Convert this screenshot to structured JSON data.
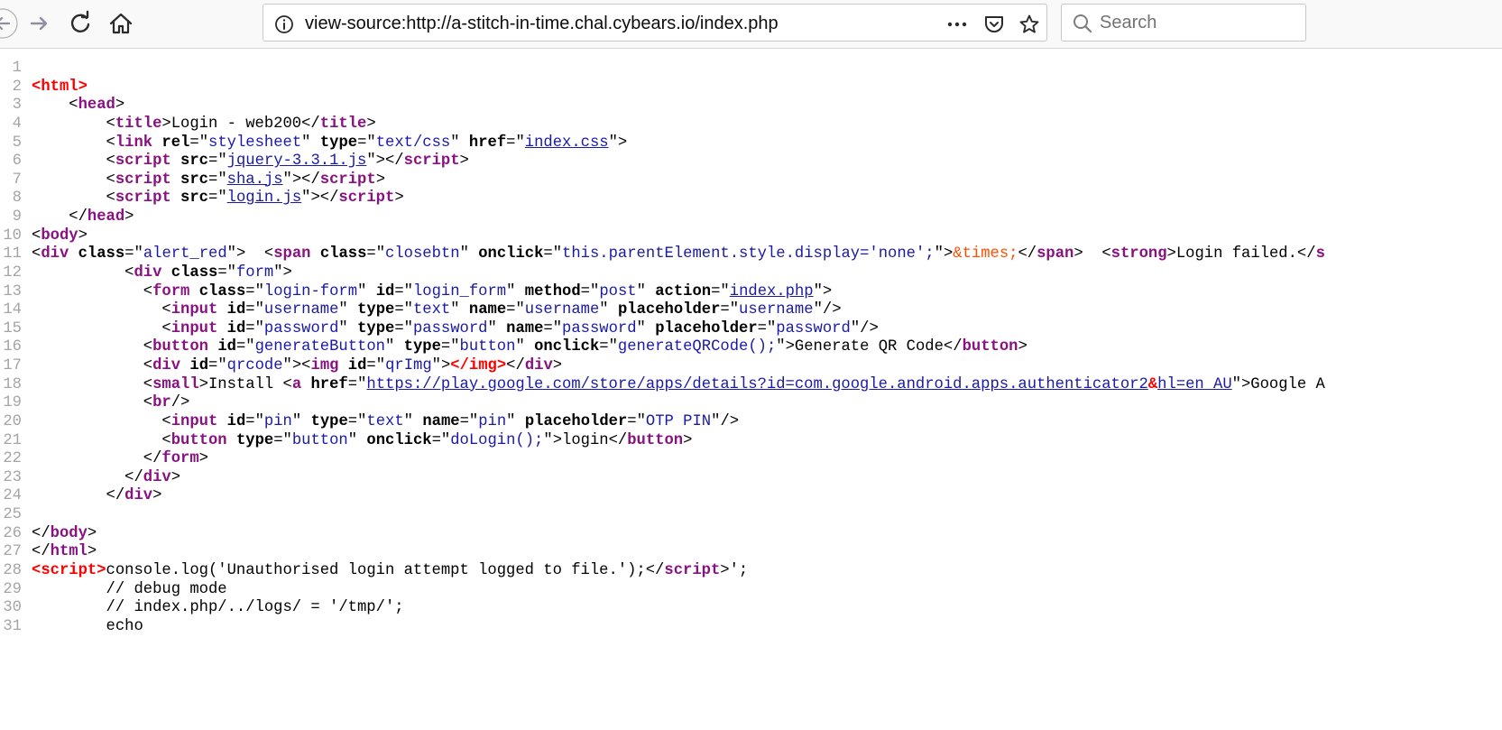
{
  "browser": {
    "url": "view-source:http://a-stitch-in-time.chal.cybears.io/index.php",
    "search_placeholder": "Search"
  },
  "source": {
    "lines": [
      [],
      [
        [
          "er",
          "<html>"
        ]
      ],
      [
        [
          "tx",
          "    <"
        ],
        [
          "tg",
          "head"
        ],
        [
          "tx",
          ">"
        ]
      ],
      [
        [
          "tx",
          "        <"
        ],
        [
          "tg",
          "title"
        ],
        [
          "tx",
          ">Login - web200</"
        ],
        [
          "tg",
          "title"
        ],
        [
          "tx",
          ">"
        ]
      ],
      [
        [
          "tx",
          "        <"
        ],
        [
          "tg",
          "link"
        ],
        [
          "tx",
          " "
        ],
        [
          "at",
          "rel"
        ],
        [
          "tx",
          "=\""
        ],
        [
          "av",
          "stylesheet"
        ],
        [
          "tx",
          "\" "
        ],
        [
          "at",
          "type"
        ],
        [
          "tx",
          "=\""
        ],
        [
          "av",
          "text/css"
        ],
        [
          "tx",
          "\" "
        ],
        [
          "at",
          "href"
        ],
        [
          "tx",
          "=\""
        ],
        [
          "lk",
          "index.css"
        ],
        [
          "tx",
          "\">"
        ]
      ],
      [
        [
          "tx",
          "        <"
        ],
        [
          "tg",
          "script"
        ],
        [
          "tx",
          " "
        ],
        [
          "at",
          "src"
        ],
        [
          "tx",
          "=\""
        ],
        [
          "lk",
          "jquery-3.3.1.js"
        ],
        [
          "tx",
          "\"></"
        ],
        [
          "tg",
          "script"
        ],
        [
          "tx",
          ">"
        ]
      ],
      [
        [
          "tx",
          "        <"
        ],
        [
          "tg",
          "script"
        ],
        [
          "tx",
          " "
        ],
        [
          "at",
          "src"
        ],
        [
          "tx",
          "=\""
        ],
        [
          "lk",
          "sha.js"
        ],
        [
          "tx",
          "\"></"
        ],
        [
          "tg",
          "script"
        ],
        [
          "tx",
          ">"
        ]
      ],
      [
        [
          "tx",
          "        <"
        ],
        [
          "tg",
          "script"
        ],
        [
          "tx",
          " "
        ],
        [
          "at",
          "src"
        ],
        [
          "tx",
          "=\""
        ],
        [
          "lk",
          "login.js"
        ],
        [
          "tx",
          "\"></"
        ],
        [
          "tg",
          "script"
        ],
        [
          "tx",
          ">"
        ]
      ],
      [
        [
          "tx",
          "    </"
        ],
        [
          "tg",
          "head"
        ],
        [
          "tx",
          ">"
        ]
      ],
      [
        [
          "tx",
          "<"
        ],
        [
          "tg",
          "body"
        ],
        [
          "tx",
          ">"
        ]
      ],
      [
        [
          "tx",
          "<"
        ],
        [
          "tg",
          "div"
        ],
        [
          "tx",
          " "
        ],
        [
          "at",
          "class"
        ],
        [
          "tx",
          "=\""
        ],
        [
          "av",
          "alert_red"
        ],
        [
          "tx",
          "\">  <"
        ],
        [
          "tg",
          "span"
        ],
        [
          "tx",
          " "
        ],
        [
          "at",
          "class"
        ],
        [
          "tx",
          "=\""
        ],
        [
          "av",
          "closebtn"
        ],
        [
          "tx",
          "\" "
        ],
        [
          "at",
          "onclick"
        ],
        [
          "tx",
          "=\""
        ],
        [
          "av",
          "this.parentElement.style.display='none';"
        ],
        [
          "tx",
          "\">"
        ],
        [
          "en",
          "&times;"
        ],
        [
          "tx",
          "</"
        ],
        [
          "tg",
          "span"
        ],
        [
          "tx",
          ">  <"
        ],
        [
          "tg",
          "strong"
        ],
        [
          "tx",
          ">Login failed.</"
        ],
        [
          "tg",
          "s"
        ]
      ],
      [
        [
          "tx",
          "          <"
        ],
        [
          "tg",
          "div"
        ],
        [
          "tx",
          " "
        ],
        [
          "at",
          "class"
        ],
        [
          "tx",
          "=\""
        ],
        [
          "av",
          "form"
        ],
        [
          "tx",
          "\">"
        ]
      ],
      [
        [
          "tx",
          "            <"
        ],
        [
          "tg",
          "form"
        ],
        [
          "tx",
          " "
        ],
        [
          "at",
          "class"
        ],
        [
          "tx",
          "=\""
        ],
        [
          "av",
          "login-form"
        ],
        [
          "tx",
          "\" "
        ],
        [
          "at",
          "id"
        ],
        [
          "tx",
          "=\""
        ],
        [
          "av",
          "login_form"
        ],
        [
          "tx",
          "\" "
        ],
        [
          "at",
          "method"
        ],
        [
          "tx",
          "=\""
        ],
        [
          "av",
          "post"
        ],
        [
          "tx",
          "\" "
        ],
        [
          "at",
          "action"
        ],
        [
          "tx",
          "=\""
        ],
        [
          "lk",
          "index.php"
        ],
        [
          "tx",
          "\">"
        ]
      ],
      [
        [
          "tx",
          "              <"
        ],
        [
          "tg",
          "input"
        ],
        [
          "tx",
          " "
        ],
        [
          "at",
          "id"
        ],
        [
          "tx",
          "=\""
        ],
        [
          "av",
          "username"
        ],
        [
          "tx",
          "\" "
        ],
        [
          "at",
          "type"
        ],
        [
          "tx",
          "=\""
        ],
        [
          "av",
          "text"
        ],
        [
          "tx",
          "\" "
        ],
        [
          "at",
          "name"
        ],
        [
          "tx",
          "=\""
        ],
        [
          "av",
          "username"
        ],
        [
          "tx",
          "\" "
        ],
        [
          "at",
          "placeholder"
        ],
        [
          "tx",
          "=\""
        ],
        [
          "av",
          "username"
        ],
        [
          "tx",
          "\"/>"
        ]
      ],
      [
        [
          "tx",
          "              <"
        ],
        [
          "tg",
          "input"
        ],
        [
          "tx",
          " "
        ],
        [
          "at",
          "id"
        ],
        [
          "tx",
          "=\""
        ],
        [
          "av",
          "password"
        ],
        [
          "tx",
          "\" "
        ],
        [
          "at",
          "type"
        ],
        [
          "tx",
          "=\""
        ],
        [
          "av",
          "password"
        ],
        [
          "tx",
          "\" "
        ],
        [
          "at",
          "name"
        ],
        [
          "tx",
          "=\""
        ],
        [
          "av",
          "password"
        ],
        [
          "tx",
          "\" "
        ],
        [
          "at",
          "placeholder"
        ],
        [
          "tx",
          "=\""
        ],
        [
          "av",
          "password"
        ],
        [
          "tx",
          "\"/>"
        ]
      ],
      [
        [
          "tx",
          "            <"
        ],
        [
          "tg",
          "button"
        ],
        [
          "tx",
          " "
        ],
        [
          "at",
          "id"
        ],
        [
          "tx",
          "=\""
        ],
        [
          "av",
          "generateButton"
        ],
        [
          "tx",
          "\" "
        ],
        [
          "at",
          "type"
        ],
        [
          "tx",
          "=\""
        ],
        [
          "av",
          "button"
        ],
        [
          "tx",
          "\" "
        ],
        [
          "at",
          "onclick"
        ],
        [
          "tx",
          "=\""
        ],
        [
          "av",
          "generateQRCode();"
        ],
        [
          "tx",
          "\">Generate QR Code</"
        ],
        [
          "tg",
          "button"
        ],
        [
          "tx",
          ">"
        ]
      ],
      [
        [
          "tx",
          "            <"
        ],
        [
          "tg",
          "div"
        ],
        [
          "tx",
          " "
        ],
        [
          "at",
          "id"
        ],
        [
          "tx",
          "=\""
        ],
        [
          "av",
          "qrcode"
        ],
        [
          "tx",
          "\"><"
        ],
        [
          "tg",
          "img"
        ],
        [
          "tx",
          " "
        ],
        [
          "at",
          "id"
        ],
        [
          "tx",
          "=\""
        ],
        [
          "av",
          "qrImg"
        ],
        [
          "tx",
          "\">"
        ],
        [
          "er",
          "</img>"
        ],
        [
          "tx",
          "</"
        ],
        [
          "tg",
          "div"
        ],
        [
          "tx",
          ">"
        ]
      ],
      [
        [
          "tx",
          "            <"
        ],
        [
          "tg",
          "small"
        ],
        [
          "tx",
          ">Install <"
        ],
        [
          "tg",
          "a"
        ],
        [
          "tx",
          " "
        ],
        [
          "at",
          "href"
        ],
        [
          "tx",
          "=\""
        ],
        [
          "lk",
          "https://play.google.com/store/apps/details?id=com.google.android.apps.authenticator2"
        ],
        [
          "er",
          "&"
        ],
        [
          "lk",
          "hl=en_AU"
        ],
        [
          "tx",
          "\">Google A"
        ]
      ],
      [
        [
          "tx",
          "            <"
        ],
        [
          "tg",
          "br"
        ],
        [
          "tx",
          "/>"
        ]
      ],
      [
        [
          "tx",
          "              <"
        ],
        [
          "tg",
          "input"
        ],
        [
          "tx",
          " "
        ],
        [
          "at",
          "id"
        ],
        [
          "tx",
          "=\""
        ],
        [
          "av",
          "pin"
        ],
        [
          "tx",
          "\" "
        ],
        [
          "at",
          "type"
        ],
        [
          "tx",
          "=\""
        ],
        [
          "av",
          "text"
        ],
        [
          "tx",
          "\" "
        ],
        [
          "at",
          "name"
        ],
        [
          "tx",
          "=\""
        ],
        [
          "av",
          "pin"
        ],
        [
          "tx",
          "\" "
        ],
        [
          "at",
          "placeholder"
        ],
        [
          "tx",
          "=\""
        ],
        [
          "av",
          "OTP PIN"
        ],
        [
          "tx",
          "\"/>"
        ]
      ],
      [
        [
          "tx",
          "              <"
        ],
        [
          "tg",
          "button"
        ],
        [
          "tx",
          " "
        ],
        [
          "at",
          "type"
        ],
        [
          "tx",
          "=\""
        ],
        [
          "av",
          "button"
        ],
        [
          "tx",
          "\" "
        ],
        [
          "at",
          "onclick"
        ],
        [
          "tx",
          "=\""
        ],
        [
          "av",
          "doLogin();"
        ],
        [
          "tx",
          "\">login</"
        ],
        [
          "tg",
          "button"
        ],
        [
          "tx",
          ">"
        ]
      ],
      [
        [
          "tx",
          "            </"
        ],
        [
          "tg",
          "form"
        ],
        [
          "tx",
          ">"
        ]
      ],
      [
        [
          "tx",
          "          </"
        ],
        [
          "tg",
          "div"
        ],
        [
          "tx",
          ">"
        ]
      ],
      [
        [
          "tx",
          "        </"
        ],
        [
          "tg",
          "div"
        ],
        [
          "tx",
          ">"
        ]
      ],
      [],
      [
        [
          "tx",
          "</"
        ],
        [
          "tg",
          "body"
        ],
        [
          "tx",
          ">"
        ]
      ],
      [
        [
          "tx",
          "</"
        ],
        [
          "tg",
          "html"
        ],
        [
          "tx",
          ">"
        ]
      ],
      [
        [
          "er",
          "<script>"
        ],
        [
          "tx",
          "console.log('Unauthorised login attempt logged to file.');</"
        ],
        [
          "tg",
          "script"
        ],
        [
          "tx",
          ">';"
        ]
      ],
      [
        [
          "tx",
          "        // debug mode"
        ]
      ],
      [
        [
          "tx",
          "        // index.php/../logs/ = '/tmp/';"
        ]
      ],
      [
        [
          "tx",
          "        echo"
        ]
      ]
    ]
  }
}
